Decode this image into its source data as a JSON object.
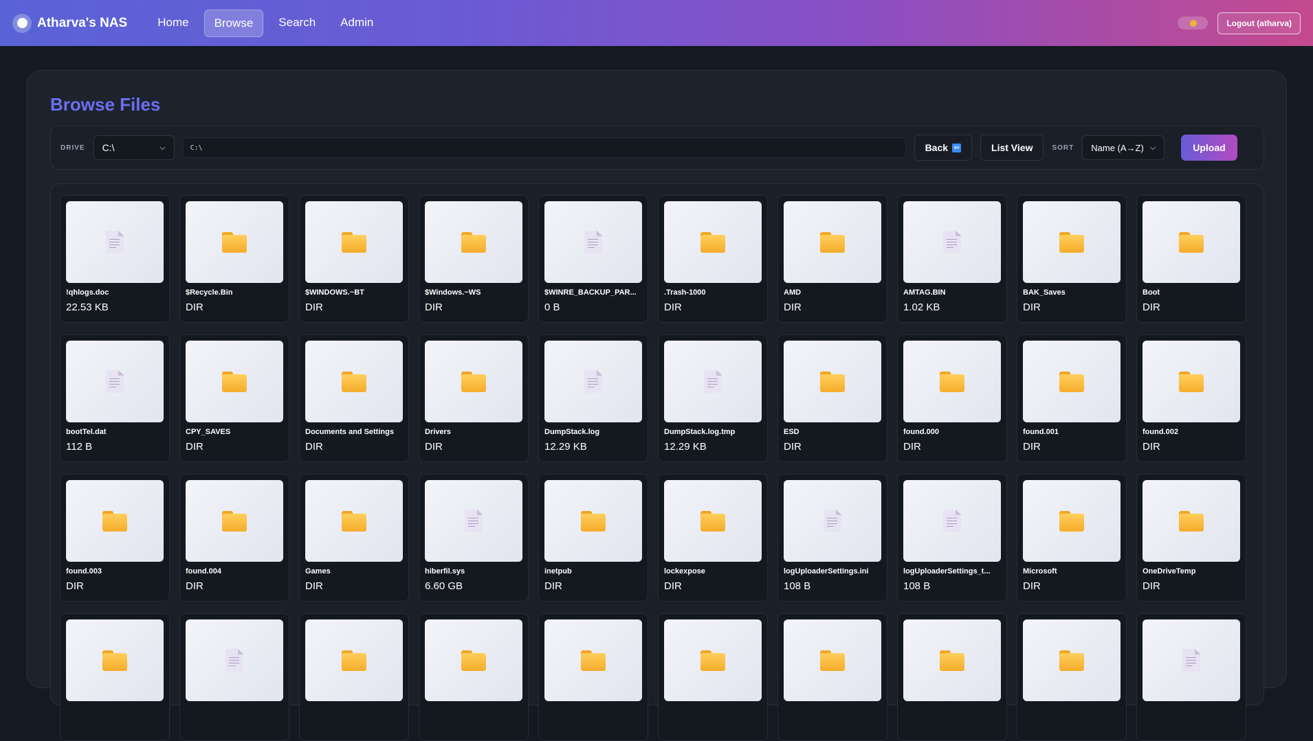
{
  "brand": {
    "name": "Atharva's NAS"
  },
  "nav": [
    "Home",
    "Browse",
    "Search",
    "Admin"
  ],
  "nav_active": "Browse",
  "logout_label": "Logout (atharva)",
  "page_title": "Browse Files",
  "toolbar": {
    "drive_label": "DRIVE",
    "drive_value": "C:\\",
    "path_value": "C:\\",
    "back_label": "Back",
    "view_label": "List View",
    "sort_label": "SORT",
    "sort_value": "Name (A→Z)",
    "upload_label": "Upload"
  },
  "files": [
    {
      "name": "!qhlogs.doc",
      "size": "22.53 KB",
      "type": "file"
    },
    {
      "name": "$Recycle.Bin",
      "size": "DIR",
      "type": "folder"
    },
    {
      "name": "$WINDOWS.~BT",
      "size": "DIR",
      "type": "folder"
    },
    {
      "name": "$Windows.~WS",
      "size": "DIR",
      "type": "folder"
    },
    {
      "name": "$WINRE_BACKUP_PAR...",
      "size": "0 B",
      "type": "file"
    },
    {
      "name": ".Trash-1000",
      "size": "DIR",
      "type": "folder"
    },
    {
      "name": "AMD",
      "size": "DIR",
      "type": "folder"
    },
    {
      "name": "AMTAG.BIN",
      "size": "1.02 KB",
      "type": "file"
    },
    {
      "name": "BAK_Saves",
      "size": "DIR",
      "type": "folder"
    },
    {
      "name": "Boot",
      "size": "DIR",
      "type": "folder"
    },
    {
      "name": "bootTel.dat",
      "size": "112 B",
      "type": "file"
    },
    {
      "name": "CPY_SAVES",
      "size": "DIR",
      "type": "folder"
    },
    {
      "name": "Documents and Settings",
      "size": "DIR",
      "type": "folder"
    },
    {
      "name": "Drivers",
      "size": "DIR",
      "type": "folder"
    },
    {
      "name": "DumpStack.log",
      "size": "12.29 KB",
      "type": "file"
    },
    {
      "name": "DumpStack.log.tmp",
      "size": "12.29 KB",
      "type": "file"
    },
    {
      "name": "ESD",
      "size": "DIR",
      "type": "folder"
    },
    {
      "name": "found.000",
      "size": "DIR",
      "type": "folder"
    },
    {
      "name": "found.001",
      "size": "DIR",
      "type": "folder"
    },
    {
      "name": "found.002",
      "size": "DIR",
      "type": "folder"
    },
    {
      "name": "found.003",
      "size": "DIR",
      "type": "folder"
    },
    {
      "name": "found.004",
      "size": "DIR",
      "type": "folder"
    },
    {
      "name": "Games",
      "size": "DIR",
      "type": "folder"
    },
    {
      "name": "hiberfil.sys",
      "size": "6.60 GB",
      "type": "file"
    },
    {
      "name": "inetpub",
      "size": "DIR",
      "type": "folder"
    },
    {
      "name": "lockexpose",
      "size": "DIR",
      "type": "folder"
    },
    {
      "name": "logUploaderSettings.ini",
      "size": "108 B",
      "type": "file"
    },
    {
      "name": "logUploaderSettings_t...",
      "size": "108 B",
      "type": "file"
    },
    {
      "name": "Microsoft",
      "size": "DIR",
      "type": "folder"
    },
    {
      "name": "OneDriveTemp",
      "size": "DIR",
      "type": "folder"
    },
    {
      "name": "",
      "size": "",
      "type": "folder"
    },
    {
      "name": "",
      "size": "",
      "type": "file"
    },
    {
      "name": "",
      "size": "",
      "type": "folder"
    },
    {
      "name": "",
      "size": "",
      "type": "folder"
    },
    {
      "name": "",
      "size": "",
      "type": "folder"
    },
    {
      "name": "",
      "size": "",
      "type": "folder"
    },
    {
      "name": "",
      "size": "",
      "type": "folder"
    },
    {
      "name": "",
      "size": "",
      "type": "folder"
    },
    {
      "name": "",
      "size": "",
      "type": "folder"
    },
    {
      "name": "",
      "size": "",
      "type": "file"
    }
  ],
  "colors": {
    "accent": "#6c6ff0",
    "folder": "#f5ac2b",
    "upload_start": "#6a5bd8",
    "upload_end": "#b14cc0"
  }
}
